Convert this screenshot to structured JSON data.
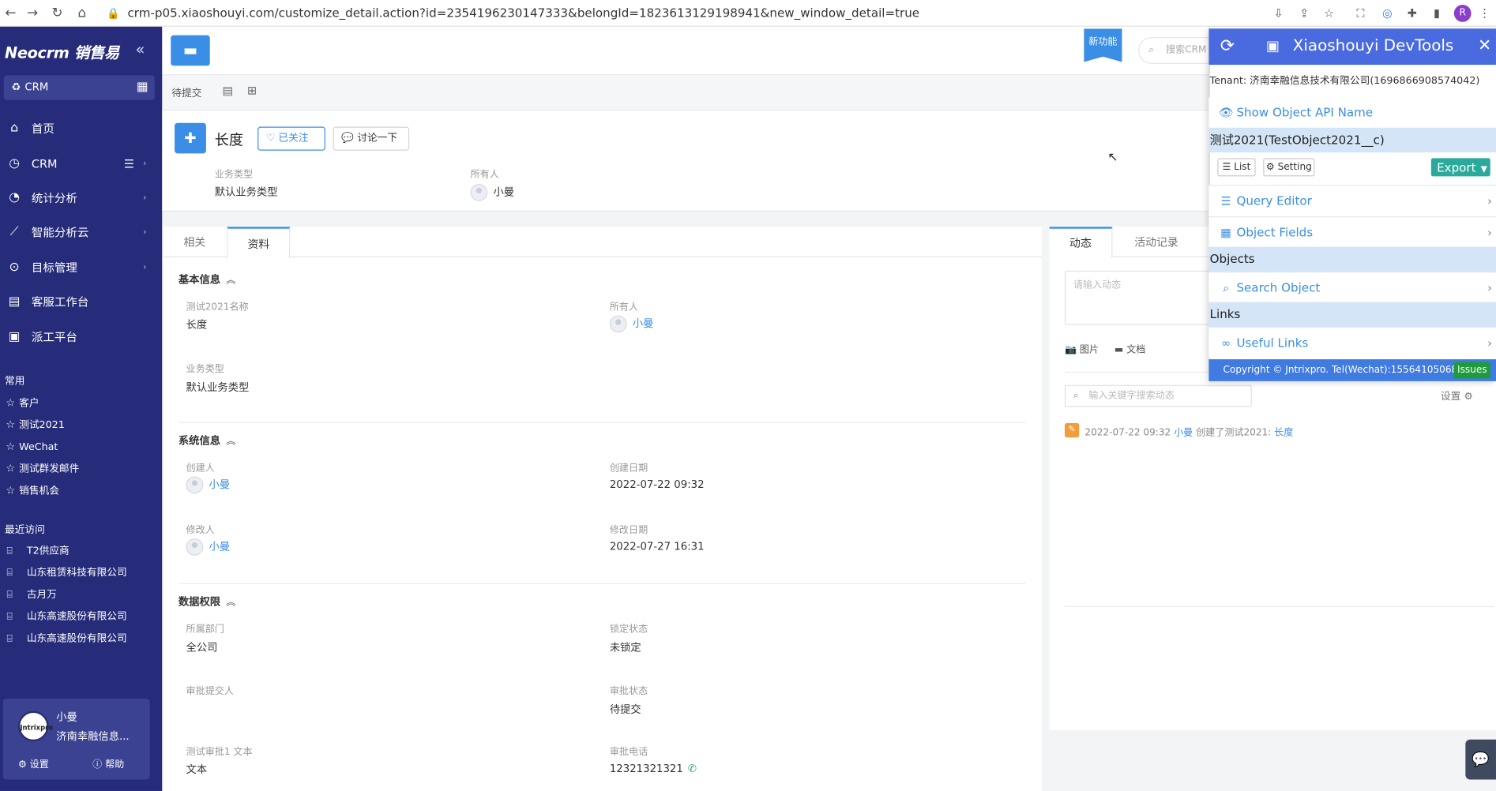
{
  "browser": {
    "url": "crm-p05.xiaoshouyi.com/customize_detail.action?id=2354196230147333&belongId=1823613129198941&new_window_detail=true",
    "profile": "R"
  },
  "sidebar": {
    "brand": "Neocrm 销售易",
    "crm_switch": "CRM",
    "menu": [
      {
        "label": "首页",
        "icon": "home-icon"
      },
      {
        "label": "CRM",
        "icon": "clock-icon"
      },
      {
        "label": "统计分析",
        "icon": "pie-chart-icon"
      },
      {
        "label": "智能分析云",
        "icon": "line-chart-icon"
      },
      {
        "label": "目标管理",
        "icon": "target-icon"
      },
      {
        "label": "客服工作台",
        "icon": "screen-icon"
      },
      {
        "label": "派工平台",
        "icon": "dispatch-icon"
      }
    ],
    "favorites_title": "常用",
    "favorites": [
      "客户",
      "测试2021",
      "WeChat",
      "测试群发邮件",
      "销售机会"
    ],
    "recent_title": "最近访问",
    "recent": [
      "T2供应商",
      "山东租赁科技有限公司",
      "古月万",
      "山东高速股份有限公司",
      "山东高速股份有限公司"
    ],
    "user": {
      "name": "小曼",
      "company": "济南幸融信息...",
      "avatar_text": "Jntrixpro",
      "settings": "设置",
      "help": "帮助"
    }
  },
  "header": {
    "new_feature": "新功能",
    "search_placeholder": "搜索CRM"
  },
  "toolbar": {
    "status": "待提交"
  },
  "record": {
    "title": "长度",
    "follow_button": "已关注",
    "discuss_button": "讨论一下",
    "business_type_label": "业务类型",
    "business_type_value": "默认业务类型",
    "owner_label": "所有人",
    "owner_value": "小曼"
  },
  "tabs": {
    "related": "相关",
    "info": "资料"
  },
  "basic": {
    "title": "基本信息",
    "name_label": "测试2021名称",
    "name_value": "长度",
    "owner_label": "所有人",
    "owner_value": "小曼",
    "type_label": "业务类型",
    "type_value": "默认业务类型"
  },
  "system": {
    "title": "系统信息",
    "creator_label": "创建人",
    "creator_value": "小曼",
    "created_label": "创建日期",
    "created_value": "2022-07-22 09:32",
    "modifier_label": "修改人",
    "modifier_value": "小曼",
    "modified_label": "修改日期",
    "modified_value": "2022-07-27 16:31"
  },
  "permission": {
    "title": "数据权限",
    "dept_label": "所属部门",
    "dept_value": "全公司",
    "lock_label": "锁定状态",
    "lock_value": "未锁定",
    "submitter_label": "审批提交人",
    "submitter_value": "",
    "approval_label": "审批状态",
    "approval_value": "待提交",
    "text_label": "测试审批1 文本",
    "text_value": "文本",
    "phone_label": "审批电话",
    "phone_value": "12321321321"
  },
  "feed": {
    "tab_dynamic": "动态",
    "tab_activity": "活动记录",
    "input_placeholder": "请输入动态",
    "picture": "图片",
    "document": "文档",
    "search_placeholder": "输入关键字搜索动态",
    "settings": "设置",
    "entry_time": "2022-07-22 09:32",
    "entry_user": "小曼",
    "entry_action": "创建了测试2021:",
    "entry_object": "长度"
  },
  "devtools": {
    "title": "Xiaoshouyi DevTools",
    "tenant": "Tenant: 济南幸融信息技术有限公司(1696866908574042)",
    "show_api_name": "Show Object API Name",
    "object_name": "测试2021(TestObject2021__c)",
    "list_btn": "List",
    "setting_btn": "Setting",
    "export_btn": "Export",
    "query_editor": "Query Editor",
    "object_fields": "Object Fields",
    "objects_section": "Objects",
    "search_object": "Search Object",
    "links_section": "Links",
    "useful_links": "Useful Links",
    "copyright": "Copyright © Jntrixpro. Tel(Wechat):15564105068",
    "issues": "Issues"
  }
}
